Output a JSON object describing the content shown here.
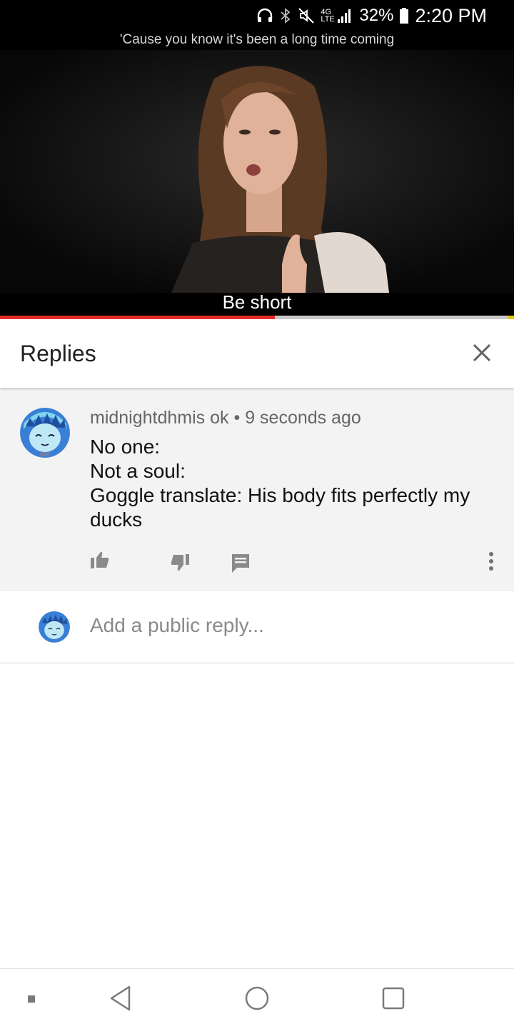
{
  "status_bar": {
    "network_label": "4G LTE",
    "battery_percent": "32%",
    "time": "2:20 PM"
  },
  "video": {
    "caption_top": "'Cause you know it's been a long time coming",
    "caption_bottom": "Be short",
    "progress": 0.535
  },
  "replies_panel": {
    "title": "Replies",
    "close_icon": "close-icon"
  },
  "comment": {
    "author": "midnightdhmis ok",
    "separator": "•",
    "timestamp": "9 seconds ago",
    "lines": [
      "No one:",
      "Not a soul:",
      "Goggle translate: His body fits perfectly my",
      "ducks"
    ],
    "actions": [
      "thumbs-up-icon",
      "thumbs-down-icon",
      "reply-icon",
      "more-vert-icon"
    ]
  },
  "reply_box": {
    "placeholder": "Add a public reply..."
  },
  "nav_bar": {
    "items": [
      "recents-dot-icon",
      "back-icon",
      "home-icon",
      "overview-icon"
    ]
  },
  "colors": {
    "progress_red": "#e52d27",
    "panel_grey": "#f3f3f3",
    "avatar_blue": "#3a7fd6"
  }
}
